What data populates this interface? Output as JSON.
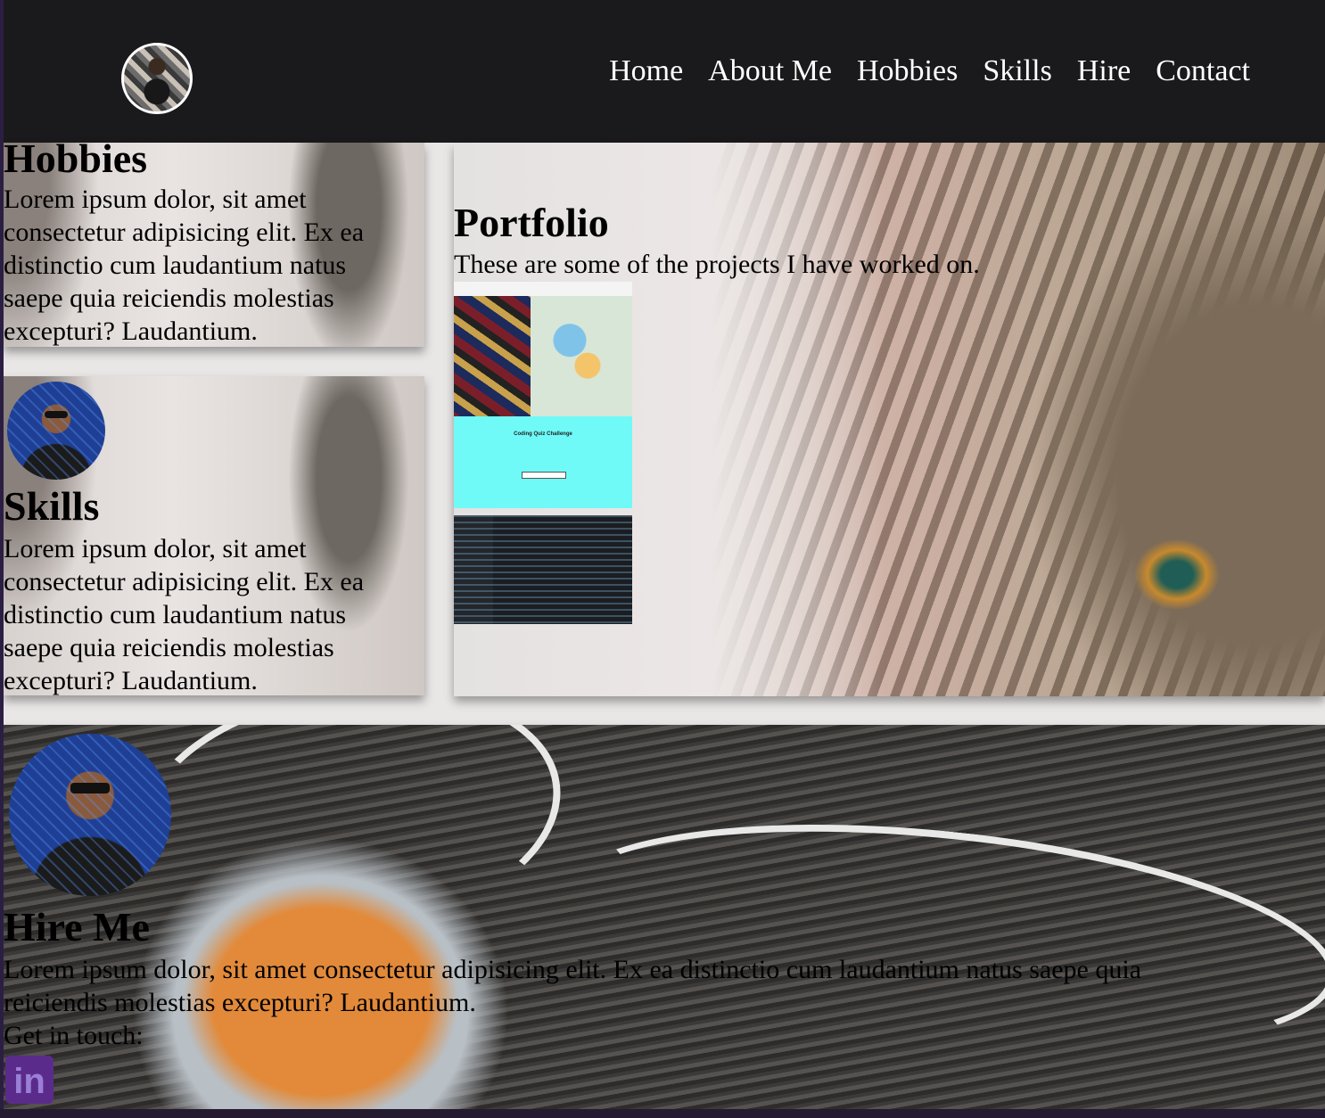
{
  "nav": {
    "items": [
      "Home",
      "About Me",
      "Hobbies",
      "Skills",
      "Hire",
      "Contact"
    ]
  },
  "hobbies": {
    "title": "Hobbies",
    "text": "Lorem ipsum dolor, sit amet consectetur adipisicing elit. Ex ea distinctio cum laudantium natus saepe quia reiciendis molestias excepturi? Laudantium."
  },
  "skills": {
    "title": "Skills",
    "text": "Lorem ipsum dolor, sit amet consectetur adipisicing elit. Ex ea distinctio cum laudantium natus saepe quia reiciendis molestias excepturi? Laudantium."
  },
  "portfolio": {
    "title": "Portfolio",
    "subtitle": "These are some of the projects I have worked on.",
    "projects": [
      {
        "name": "project-thumbnail-movie-app"
      },
      {
        "name": "project-thumbnail-coding-quiz",
        "heading": "Coding Quiz Challenge"
      },
      {
        "name": "project-thumbnail-code-editor"
      }
    ]
  },
  "hire": {
    "title": "Hire Me",
    "text": "Lorem ipsum dolor, sit amet consectetur adipisicing elit. Ex ea distinctio cum laudantium natus saepe quia reiciendis molestias excepturi? Laudantium.",
    "cta": "Get in touch:",
    "linkedin_glyph": "in"
  },
  "colors": {
    "header_bg": "#1a1a1c",
    "nav_text": "#ffffff",
    "linkedin": "#5b2b8c",
    "quiz_bg": "#6ffaf8"
  }
}
